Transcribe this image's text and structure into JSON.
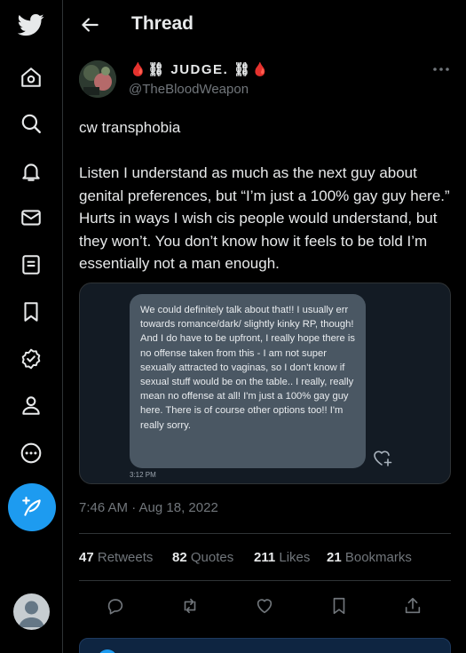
{
  "nav": {
    "items": [
      "twitter-logo",
      "home",
      "explore",
      "notifications",
      "messages",
      "lists",
      "bookmarks",
      "verified",
      "profile",
      "more"
    ],
    "compose_color": "#1d9bf0"
  },
  "header": {
    "title": "Thread"
  },
  "tweet": {
    "author_name": "🩸⛓ JUDGE. ⛓🩸",
    "author_handle": "@TheBloodWeapon",
    "text": "cw transphobia\n\nListen I understand as much as the next guy about genital preferences, but “I’m just a 100% gay guy here.” Hurts in ways I wish cis people would understand, but they won’t.  You don’t know how it feels to be told I’m essentially not a man enough.",
    "image": {
      "message": "We could definitely talk about that!! I usually err towards romance/dark/ slightly kinky RP, though! And I do have to be upfront, I really hope there is no offense taken from this - I am not super sexually attracted to vaginas, so I don't know if sexual stuff would be on the table.. I really, really mean no offense at all! I'm just a 100% gay guy here. There is of course other options too!! I'm really sorry.",
      "time": "3:12 PM"
    },
    "timestamp": "7:46 AM · Aug 18, 2022",
    "stats": {
      "retweets_count": "47",
      "retweets_label": "Retweets",
      "quotes_count": "82",
      "quotes_label": "Quotes",
      "likes_count": "211",
      "likes_label": "Likes",
      "bookmarks_count": "21",
      "bookmarks_label": "Bookmarks"
    }
  },
  "colors": {
    "background": "#000000",
    "text": "#e7e9ea",
    "muted": "#71767b",
    "accent": "#1d9bf0",
    "divider": "#2f3336"
  }
}
